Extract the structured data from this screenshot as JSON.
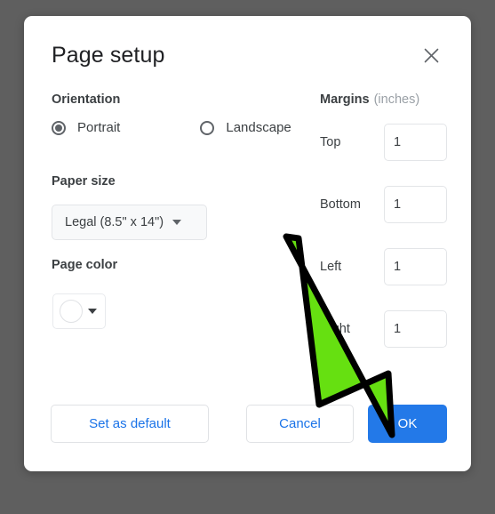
{
  "dialog": {
    "title": "Page setup",
    "close_icon": "close-icon"
  },
  "orientation": {
    "label": "Orientation",
    "selected": "Portrait",
    "options": [
      {
        "label": "Portrait",
        "checked": true
      },
      {
        "label": "Landscape",
        "checked": false
      }
    ]
  },
  "paper_size": {
    "label": "Paper size",
    "value": "Legal (8.5\" x 14\")",
    "caret_icon": "chevron-down-icon"
  },
  "page_color": {
    "label": "Page color",
    "swatch_color": "#ffffff",
    "caret_icon": "chevron-down-icon"
  },
  "margins": {
    "title": "Margins",
    "units": "(inches)",
    "fields": [
      {
        "label": "Top",
        "value": "1"
      },
      {
        "label": "Bottom",
        "value": "1"
      },
      {
        "label": "Left",
        "value": "1"
      },
      {
        "label": "Right",
        "value": "1"
      }
    ]
  },
  "footer": {
    "set_default_label": "Set as default",
    "cancel_label": "Cancel",
    "ok_label": "OK"
  },
  "annotation": {
    "shape": "arrow",
    "fill_color": "#66e011",
    "stroke_color": "#000000",
    "points_to": "OK"
  },
  "colors": {
    "backdrop": "#5f5f5f",
    "dialog_background": "#ffffff",
    "primary_button": "#2379e8",
    "link_text": "#1a73e8",
    "body_text": "#3c4043",
    "muted_text": "#9aa0a6"
  }
}
